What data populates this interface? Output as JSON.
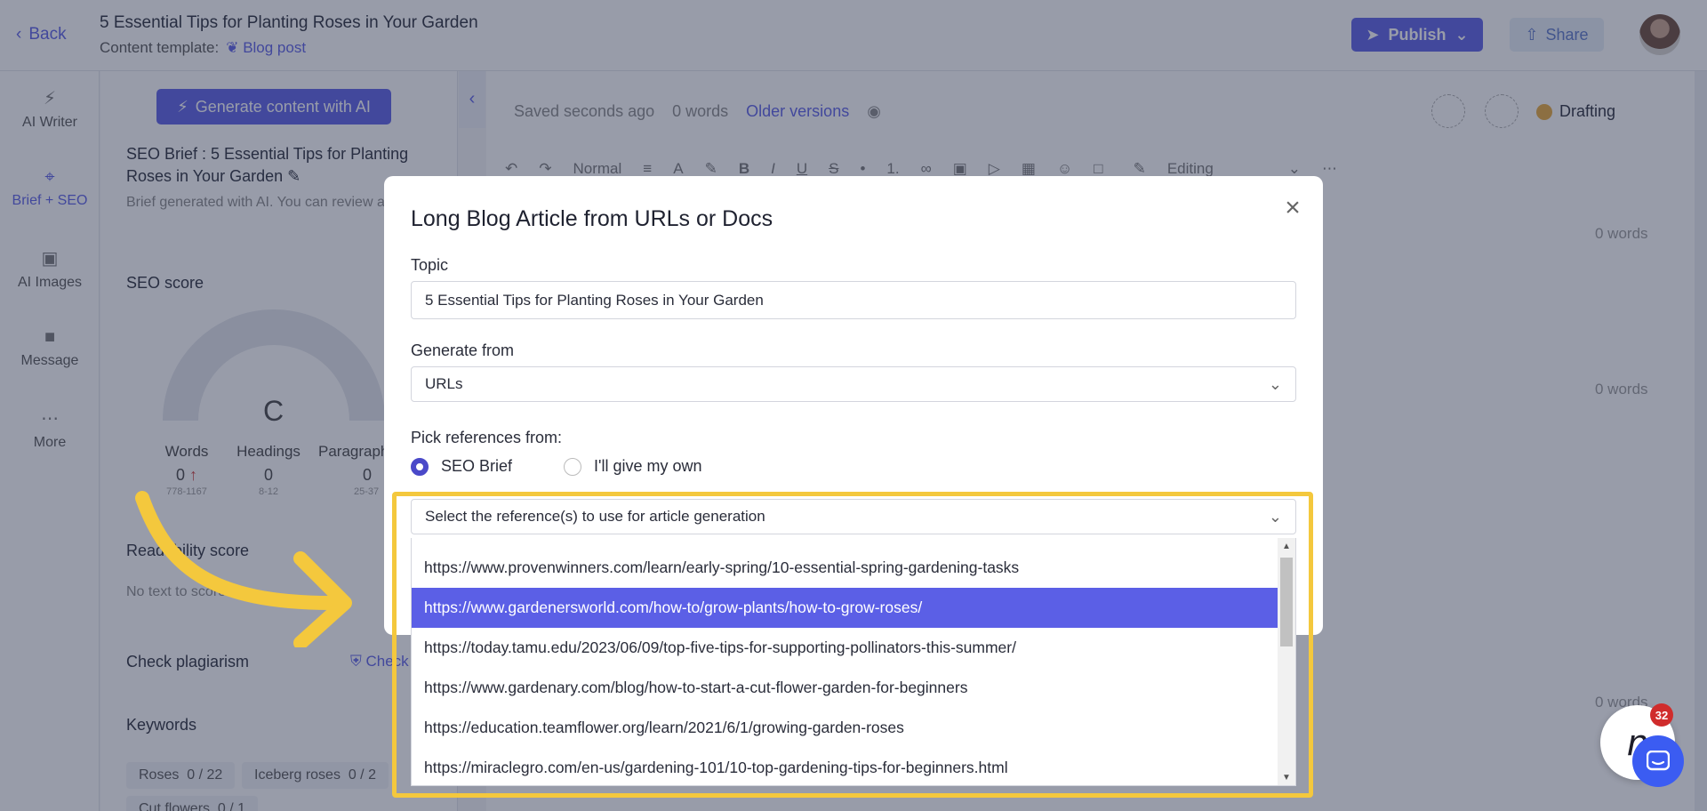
{
  "header": {
    "back_label": "Back",
    "doc_title": "5 Essential Tips for Planting Roses in Your Garden",
    "template_label": "Content template:",
    "template_value": "Blog post",
    "publish_label": "Publish",
    "share_label": "Share"
  },
  "rail": {
    "items": [
      {
        "label": "AI Writer",
        "icon": "bolt-icon"
      },
      {
        "label": "Brief + SEO",
        "icon": "target-icon"
      },
      {
        "label": "AI Images",
        "icon": "image-icon"
      },
      {
        "label": "Message",
        "icon": "chat-icon"
      },
      {
        "label": "More",
        "icon": "ellipsis-icon"
      }
    ]
  },
  "panel": {
    "generate_label": "Generate content with AI",
    "brief_title": "SEO Brief : 5 Essential Tips for Planting Roses in Your Garden",
    "brief_sub": "Brief generated with AI. You can review and edit it.",
    "seo_score_label": "SEO score",
    "grade": "C",
    "stats": [
      {
        "label": "Words",
        "value": "0",
        "range": "778-1167"
      },
      {
        "label": "Headings",
        "value": "0",
        "range": "8-12"
      },
      {
        "label": "Paragraphs",
        "value": "0",
        "range": "25-37"
      }
    ],
    "readability_label": "Readability score",
    "readability_text": "No text to score",
    "plagiarism_label": "Check plagiarism",
    "plagiarism_button": "Check",
    "keywords_label": "Keywords",
    "keywords": [
      {
        "label": "Roses",
        "count": "0 / 22"
      },
      {
        "label": "Iceberg roses",
        "count": "0 / 2"
      },
      {
        "label": "Cut flowers",
        "count": "0 / 1"
      }
    ]
  },
  "editor": {
    "saved": "Saved seconds ago",
    "words": "0 words",
    "older": "Older versions",
    "status": "Drafting",
    "style_select": "Normal",
    "editing_label": "Editing",
    "section_words": "0 words"
  },
  "modal": {
    "title": "Long Blog Article from URLs or Docs",
    "topic_label": "Topic",
    "topic_value": "5 Essential Tips for Planting Roses in Your Garden",
    "generate_from_label": "Generate from",
    "generate_from_value": "URLs",
    "pick_label": "Pick references from:",
    "radio_seo": "SEO Brief",
    "radio_own": "I'll give my own",
    "ref_placeholder": "Select the reference(s) to use for article generation",
    "options": [
      "https://www.provenwinners.com/learn/early-spring/10-essential-spring-gardening-tasks",
      "https://www.gardenersworld.com/how-to/grow-plants/how-to-grow-roses/",
      "https://today.tamu.edu/2023/06/09/top-five-tips-for-supporting-pollinators-this-summer/",
      "https://www.gardenary.com/blog/how-to-start-a-cut-flower-garden-for-beginners",
      "https://education.teamflower.org/learn/2021/6/1/growing-garden-roses",
      "https://miraclegro.com/en-us/gardening-101/10-top-gardening-tips-for-beginners.html"
    ],
    "selected_index": 1
  },
  "widgets": {
    "notif_count": "32",
    "fab_letter": "n"
  },
  "colors": {
    "accent": "#5b5fe6",
    "highlight": "#f4c83d",
    "badge": "#d02c2c",
    "drafting": "#e8a93a"
  }
}
